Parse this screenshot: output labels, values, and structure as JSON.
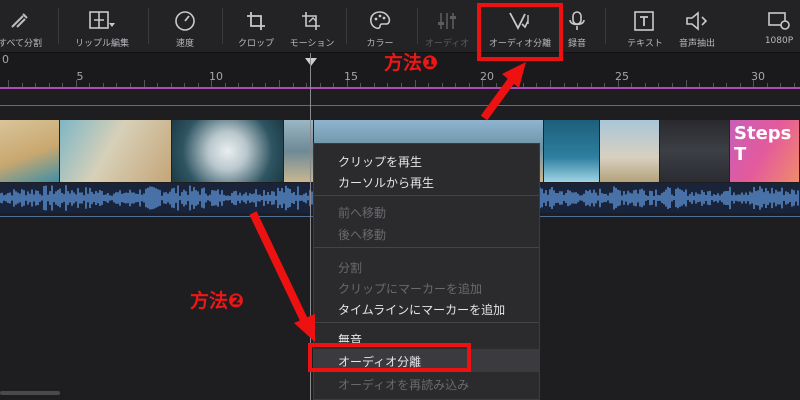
{
  "toolbar": {
    "items": [
      {
        "label": "すべて分割",
        "icon": "split-all-icon"
      },
      {
        "label": "リップル編集",
        "icon": "ripple-edit-icon"
      },
      {
        "label": "速度",
        "icon": "speed-gauge-icon"
      },
      {
        "label": "クロップ",
        "icon": "crop-icon"
      },
      {
        "label": "モーション",
        "icon": "motion-icon"
      },
      {
        "label": "カラー",
        "icon": "color-palette-icon"
      },
      {
        "label": "オーディオ",
        "icon": "audio-adjust-icon"
      },
      {
        "label": "オーディオ分離",
        "icon": "audio-split-icon"
      },
      {
        "label": "録音",
        "icon": "microphone-icon"
      },
      {
        "label": "テキスト",
        "icon": "text-icon"
      },
      {
        "label": "音声抽出",
        "icon": "audio-extract-icon"
      },
      {
        "label": "1080P",
        "icon": "export-settings-icon"
      }
    ]
  },
  "ruler": {
    "left_marker": "0",
    "ticks": [
      "5",
      "10",
      "15",
      "20",
      "25",
      "30"
    ]
  },
  "clip": {
    "overlay_text": "Steps T"
  },
  "context_menu": {
    "items": [
      "クリップを再生",
      "カーソルから再生",
      "前へ移動",
      "後へ移動",
      "分割",
      "クリップにマーカーを追加",
      "タイムラインにマーカーを追加",
      "無音",
      "オーディオ分離",
      "オーディオを再読み込み"
    ],
    "disabled": [
      "前へ移動",
      "後へ移動",
      "分割",
      "クリップにマーカーを追加",
      "オーディオを再読み込み"
    ],
    "highlighted": "オーディオ分離"
  },
  "annotations": {
    "method1": "方法❶",
    "method2": "方法❷",
    "color": "#ee1111"
  }
}
